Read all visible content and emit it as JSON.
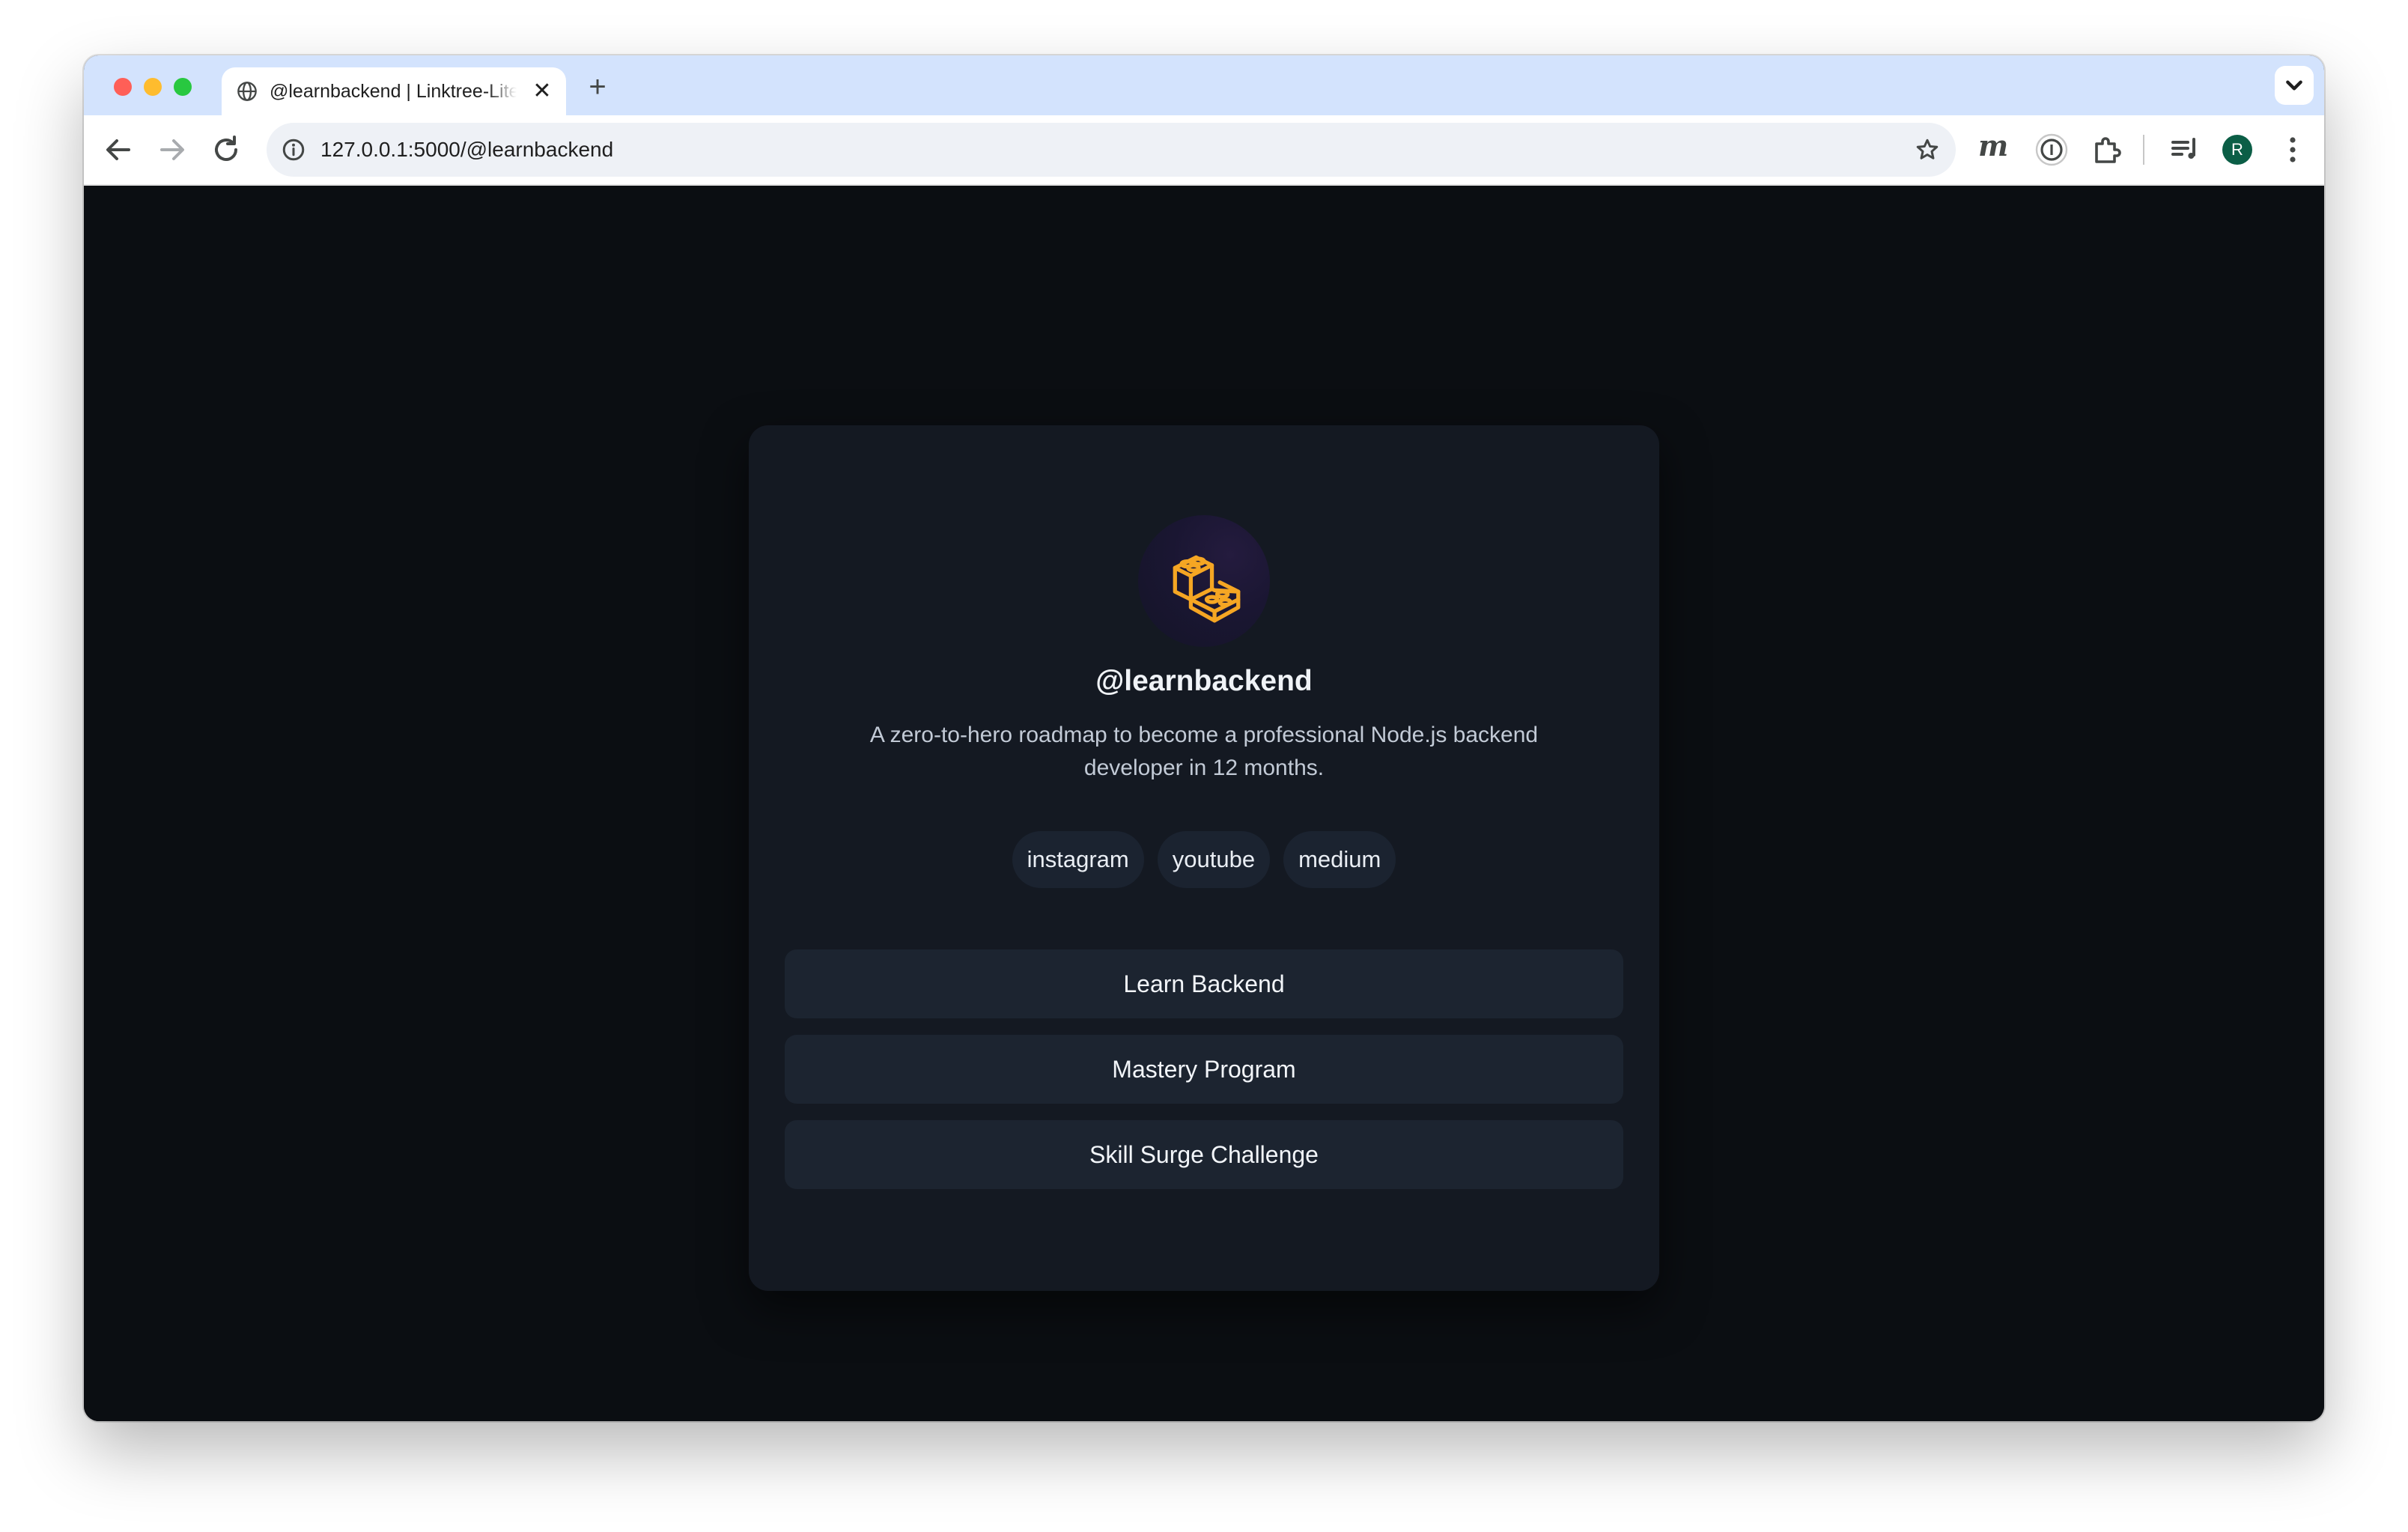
{
  "browser": {
    "tab": {
      "title": "@learnbackend | Linktree-Lite",
      "close_glyph": "✕",
      "favicon": "globe-icon"
    },
    "new_tab_glyph": "+",
    "url": "127.0.0.1:5000/@learnbackend",
    "extensions": {
      "m_label": "m",
      "profile_initial": "R"
    },
    "colors": {
      "tab_strip": "#d3e3fd",
      "profile": "#0b5e46"
    }
  },
  "profile": {
    "avatar_icon": "lego-bricks-icon",
    "username": "@learnbackend",
    "bio": "A zero-to-hero roadmap to become a professional Node.js backend developer in 12 months.",
    "socials": [
      "instagram",
      "youtube",
      "medium"
    ],
    "links": [
      "Learn Backend",
      "Mastery Program",
      "Skill Surge Challenge"
    ],
    "colors": {
      "page_bg": "#0b0e12",
      "card_bg": "#141922",
      "button_bg": "#1c2430",
      "icon_accent": "#f5a623"
    }
  }
}
